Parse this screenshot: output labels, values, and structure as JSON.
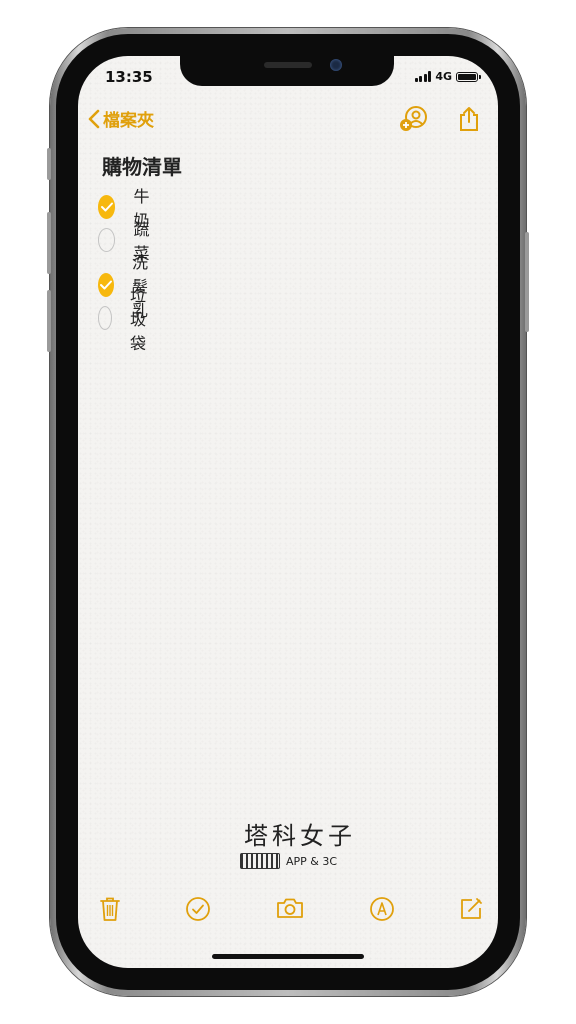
{
  "status_bar": {
    "time": "13:35",
    "network": "4G"
  },
  "nav": {
    "back_label": "檔案夾",
    "icons": [
      "add-person-icon",
      "share-icon"
    ]
  },
  "note": {
    "title": "購物清單",
    "items": [
      {
        "label": "牛奶",
        "checked": true
      },
      {
        "label": "蔬菜",
        "checked": false
      },
      {
        "label": "洗髮乳",
        "checked": true
      },
      {
        "label": "垃圾袋",
        "checked": false
      }
    ]
  },
  "watermark": {
    "title": "塔科女子",
    "subtitle": "APP & 3C"
  },
  "toolbar": {
    "icons": [
      "trash-icon",
      "checklist-icon",
      "camera-icon",
      "markup-icon",
      "compose-icon"
    ]
  },
  "colors": {
    "accent": "#e0a00c",
    "check_fill": "#f7b80e",
    "paper": "#f4f3f1"
  }
}
